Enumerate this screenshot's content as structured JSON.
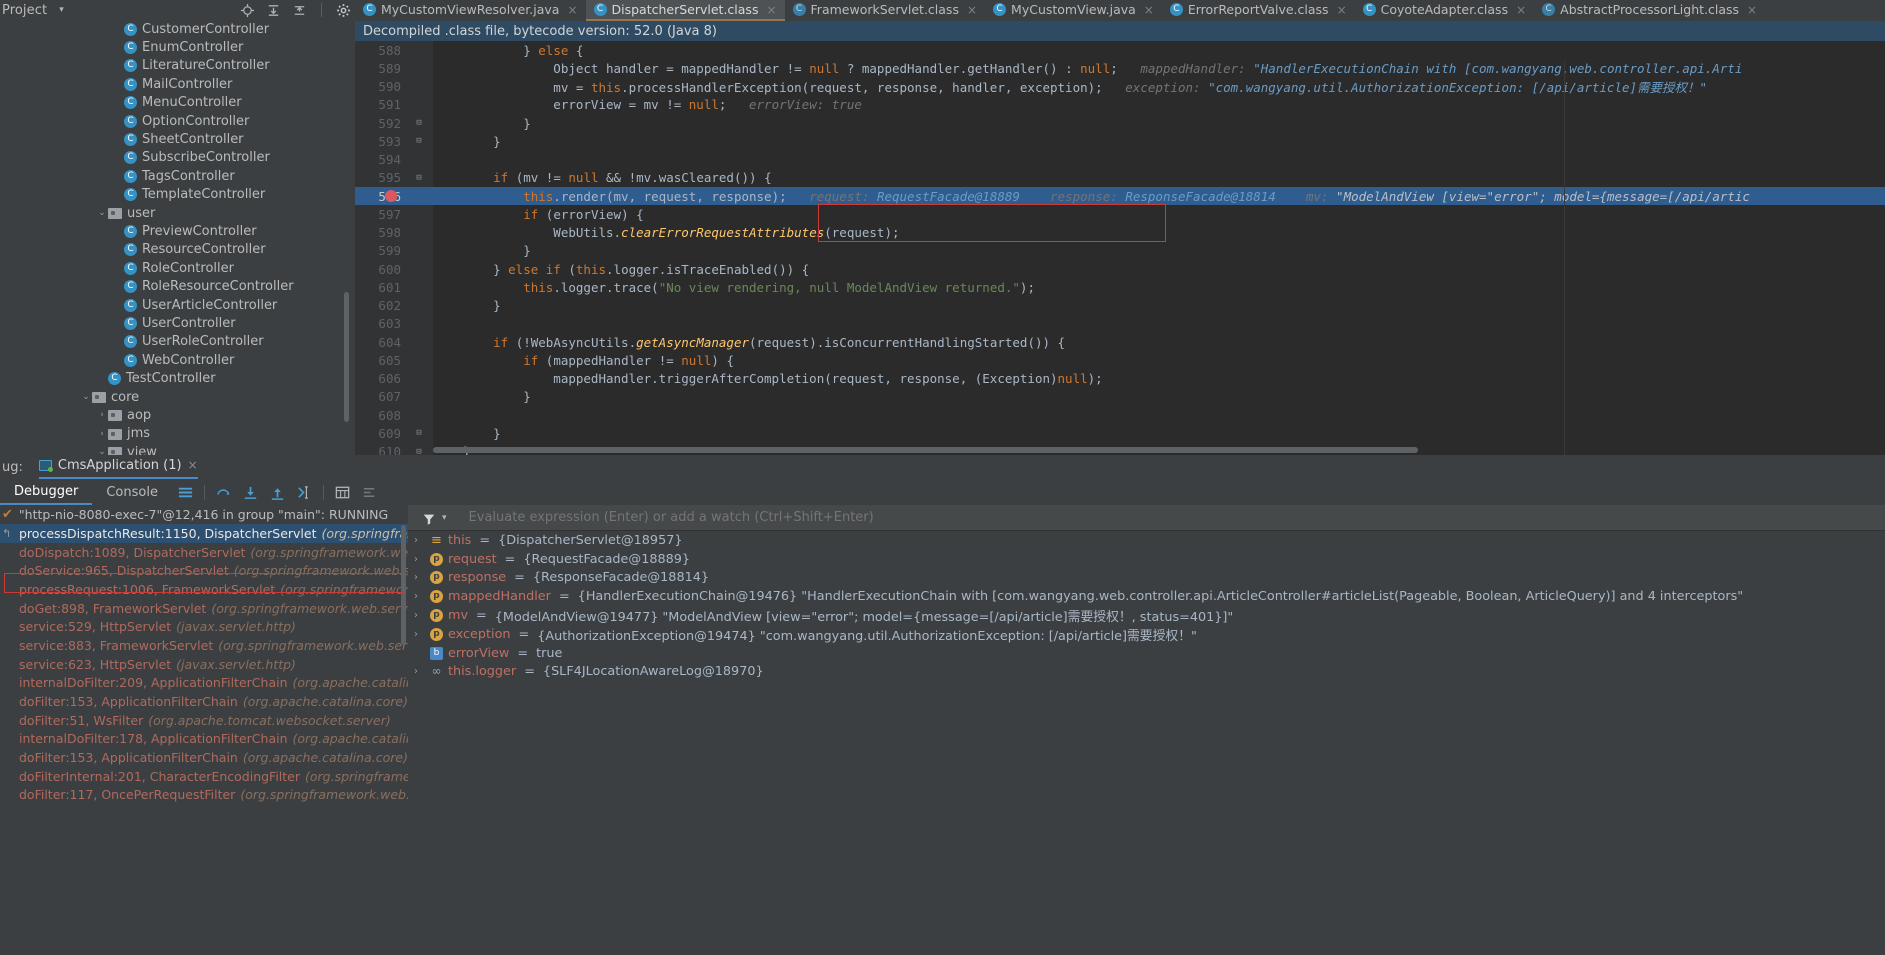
{
  "topbar": {
    "project_label": "Project",
    "caret": "▾",
    "icons": [
      "locate-icon",
      "expand-all-icon",
      "collapse-all-icon",
      "settings-gear-icon",
      "minimize-icon"
    ]
  },
  "editor_tabs": [
    {
      "label": "MyCustomViewResolver.java",
      "icon": "java-class-icon",
      "active": false,
      "close": "×"
    },
    {
      "label": "DispatcherServlet.class",
      "icon": "java-class-icon",
      "active": true,
      "close": "×"
    },
    {
      "label": "FrameworkServlet.class",
      "icon": "compiled-class-icon",
      "active": false,
      "close": "×"
    },
    {
      "label": "MyCustomView.java",
      "icon": "java-class-icon",
      "active": false,
      "close": "×"
    },
    {
      "label": "ErrorReportValve.class",
      "icon": "java-class-icon",
      "active": false,
      "close": "×"
    },
    {
      "label": "CoyoteAdapter.class",
      "icon": "java-class-icon",
      "active": false,
      "close": "×"
    },
    {
      "label": "AbstractProcessorLight.class",
      "icon": "compiled-class-icon",
      "active": false,
      "close": "×"
    }
  ],
  "project_tree": [
    {
      "label": "CustomerController",
      "kind": "class",
      "indent": 7,
      "twisty": ""
    },
    {
      "label": "EnumController",
      "kind": "class",
      "indent": 7,
      "twisty": ""
    },
    {
      "label": "LiteratureController",
      "kind": "class",
      "indent": 7,
      "twisty": ""
    },
    {
      "label": "MailController",
      "kind": "class",
      "indent": 7,
      "twisty": ""
    },
    {
      "label": "MenuController",
      "kind": "class",
      "indent": 7,
      "twisty": ""
    },
    {
      "label": "OptionController",
      "kind": "class",
      "indent": 7,
      "twisty": ""
    },
    {
      "label": "SheetController",
      "kind": "class",
      "indent": 7,
      "twisty": ""
    },
    {
      "label": "SubscribeController",
      "kind": "class",
      "indent": 7,
      "twisty": ""
    },
    {
      "label": "TagsController",
      "kind": "class",
      "indent": 7,
      "twisty": ""
    },
    {
      "label": "TemplateController",
      "kind": "class",
      "indent": 7,
      "twisty": ""
    },
    {
      "label": "user",
      "kind": "folder",
      "indent": 6,
      "twisty": "⌄"
    },
    {
      "label": "PreviewController",
      "kind": "class",
      "indent": 7,
      "twisty": ""
    },
    {
      "label": "ResourceController",
      "kind": "class",
      "indent": 7,
      "twisty": ""
    },
    {
      "label": "RoleController",
      "kind": "class",
      "indent": 7,
      "twisty": ""
    },
    {
      "label": "RoleResourceController",
      "kind": "class",
      "indent": 7,
      "twisty": ""
    },
    {
      "label": "UserArticleController",
      "kind": "class",
      "indent": 7,
      "twisty": ""
    },
    {
      "label": "UserController",
      "kind": "class",
      "indent": 7,
      "twisty": ""
    },
    {
      "label": "UserRoleController",
      "kind": "class",
      "indent": 7,
      "twisty": ""
    },
    {
      "label": "WebController",
      "kind": "class",
      "indent": 7,
      "twisty": ""
    },
    {
      "label": "TestController",
      "kind": "class",
      "indent": 6,
      "twisty": ""
    },
    {
      "label": "core",
      "kind": "folder",
      "indent": 5,
      "twisty": "⌄"
    },
    {
      "label": "aop",
      "kind": "folder",
      "indent": 6,
      "twisty": "›"
    },
    {
      "label": "jms",
      "kind": "folder",
      "indent": 6,
      "twisty": "›"
    },
    {
      "label": "view",
      "kind": "folder",
      "indent": 6,
      "twisty": "⌄"
    }
  ],
  "editor": {
    "banner": "Decompiled .class file, bytecode version: 52.0 (Java 8)",
    "first_line": 588,
    "lines": [
      {
        "num": 588,
        "fold": "",
        "html": "        } <span class='kw'>else</span> {"
      },
      {
        "num": 589,
        "fold": "",
        "html": "            Object handler = mappedHandler != <span class='kw'>null</span> ? mappedHandler.getHandler() : <span class='kw'>null</span>;   <span class='hint'>mappedHandler: </span><span class='hint2'>\"HandlerExecutionChain with [com.wangyang.web.controller.api.Arti</span>"
      },
      {
        "num": 590,
        "fold": "",
        "html": "            mv = <span class='kw'>this</span>.processHandlerException(request, response, handler, exception);   <span class='hint'>exception: </span><span class='hint2'>\"com.wangyang.util.AuthorizationException: [/api/article]需要授权！\"</span>"
      },
      {
        "num": 591,
        "fold": "",
        "html": "            errorView = mv != <span class='kw'>null</span>;   <span class='hint'>errorView: true</span>"
      },
      {
        "num": 592,
        "fold": "⊟",
        "html": "        }"
      },
      {
        "num": 593,
        "fold": "⊟",
        "html": "    }"
      },
      {
        "num": 594,
        "fold": "",
        "html": ""
      },
      {
        "num": 595,
        "fold": "⊟",
        "html": "    <span class='kw'>if</span> (mv != <span class='kw'>null</span> &amp;&amp; !mv.wasCleared()) {"
      },
      {
        "num": 596,
        "fold": "",
        "sel": true,
        "bp": true,
        "html": "        <span class='kw'>this</span>.render(mv, request, response);   <span class='hint'>request: </span><span class='hint2'>RequestFacade@18889</span>    <span class='hint'>response: </span><span class='hint2'>ResponseFacade@18814</span>    <span class='hint'>mv: </span><span class='hintw'>\"ModelAndView [view=\"error\"; model={message=[/api/artic</span>"
      },
      {
        "num": 597,
        "fold": "",
        "html": "        <span class='kw'>if</span> (errorView) {"
      },
      {
        "num": 598,
        "fold": "",
        "html": "            WebUtils.<span class='fn' style='font-style:italic'>clearErrorRequestAttributes</span>(request);"
      },
      {
        "num": 599,
        "fold": "",
        "html": "        }"
      },
      {
        "num": 600,
        "fold": "",
        "html": "    } <span class='kw'>else if</span> (<span class='kw'>this</span>.logger.isTraceEnabled()) {"
      },
      {
        "num": 601,
        "fold": "",
        "html": "        <span class='kw'>this</span>.logger.trace(<span class='str'>\"No view rendering, null ModelAndView returned.\"</span>);"
      },
      {
        "num": 602,
        "fold": "",
        "html": "    }"
      },
      {
        "num": 603,
        "fold": "",
        "html": ""
      },
      {
        "num": 604,
        "fold": "",
        "html": "    <span class='kw'>if</span> (!WebAsyncUtils.<span class='fn' style='font-style:italic'>getAsyncManager</span>(request).isConcurrentHandlingStarted()) {"
      },
      {
        "num": 605,
        "fold": "",
        "html": "        <span class='kw'>if</span> (mappedHandler != <span class='kw'>null</span>) {"
      },
      {
        "num": 606,
        "fold": "",
        "html": "            mappedHandler.triggerAfterCompletion(request, response, (Exception)<span class='kw'>null</span>);"
      },
      {
        "num": 607,
        "fold": "",
        "html": "        }"
      },
      {
        "num": 608,
        "fold": "",
        "html": ""
      },
      {
        "num": 609,
        "fold": "⊟",
        "html": "    }"
      },
      {
        "num": 610,
        "fold": "⊟",
        "html": "}"
      }
    ]
  },
  "debug": {
    "label": "ug:",
    "session_tab": "CmsApplication (1)",
    "session_close": "×",
    "tabs": [
      {
        "label": "Debugger",
        "active": true
      },
      {
        "label": "Console",
        "active": false
      }
    ],
    "toolbar_icons": [
      "layout-settings-icon",
      "step-over-icon",
      "step-into-icon",
      "step-out-icon",
      "run-to-cursor-icon",
      "evaluate-expression-icon",
      "mute-breakpoints-icon"
    ],
    "thread": "\"http-nio-8080-exec-7\"@12,416 in group \"main\": RUNNING",
    "frames": [
      {
        "method": "processDispatchResult:1150, DispatcherServlet",
        "pkg": "(org.springframework",
        "selected": true
      },
      {
        "method": "doDispatch:1089, DispatcherServlet",
        "pkg": "(org.springframework.web.servle",
        "selected": false
      },
      {
        "method": "doService:965, DispatcherServlet",
        "pkg": "(org.springframework.web.servlet)",
        "selected": false
      },
      {
        "method": "processRequest:1006, FrameworkServlet",
        "pkg": "(org.springframework.web.s",
        "selected": false
      },
      {
        "method": "doGet:898, FrameworkServlet",
        "pkg": "(org.springframework.web.servlet)",
        "selected": false
      },
      {
        "method": "service:529, HttpServlet",
        "pkg": "(javax.servlet.http)",
        "selected": false
      },
      {
        "method": "service:883, FrameworkServlet",
        "pkg": "(org.springframework.web.servlet)",
        "selected": false
      },
      {
        "method": "service:623, HttpServlet",
        "pkg": "(javax.servlet.http)",
        "selected": false
      },
      {
        "method": "internalDoFilter:209, ApplicationFilterChain",
        "pkg": "(org.apache.catalina.core",
        "selected": false
      },
      {
        "method": "doFilter:153, ApplicationFilterChain",
        "pkg": "(org.apache.catalina.core)",
        "selected": false
      },
      {
        "method": "doFilter:51, WsFilter",
        "pkg": "(org.apache.tomcat.websocket.server)",
        "selected": false
      },
      {
        "method": "internalDoFilter:178, ApplicationFilterChain",
        "pkg": "(org.apache.catalina.core",
        "selected": false
      },
      {
        "method": "doFilter:153, ApplicationFilterChain",
        "pkg": "(org.apache.catalina.core)",
        "selected": false
      },
      {
        "method": "doFilterInternal:201, CharacterEncodingFilter",
        "pkg": "(org.springframework.w",
        "selected": false
      },
      {
        "method": "doFilter:117, OncePerRequestFilter",
        "pkg": "(org.springframework.web.filter)",
        "selected": false
      }
    ],
    "eval_placeholder": "Evaluate expression (Enter) or add a watch (Ctrl+Shift+Enter)",
    "variables": [
      {
        "chevron": "›",
        "icon": "this-icon",
        "name": "this",
        "eq": "=",
        "value": "{DispatcherServlet@18957}"
      },
      {
        "chevron": "›",
        "icon": "param-icon",
        "name": "request",
        "eq": "=",
        "value": "{RequestFacade@18889}"
      },
      {
        "chevron": "›",
        "icon": "param-icon",
        "name": "response",
        "eq": "=",
        "value": "{ResponseFacade@18814}"
      },
      {
        "chevron": "›",
        "icon": "param-icon",
        "name": "mappedHandler",
        "eq": "=",
        "value": "{HandlerExecutionChain@19476} \"HandlerExecutionChain with [com.wangyang.web.controller.api.ArticleController#articleList(Pageable, Boolean, ArticleQuery)] and 4 interceptors\""
      },
      {
        "chevron": "›",
        "icon": "param-icon",
        "name": "mv",
        "eq": "=",
        "value": "{ModelAndView@19477} \"ModelAndView [view=\"error\"; model={message=[/api/article]需要授权！, status=401}]\""
      },
      {
        "chevron": "›",
        "icon": "param-icon",
        "name": "exception",
        "eq": "=",
        "value": "{AuthorizationException@19474} \"com.wangyang.util.AuthorizationException: [/api/article]需要授权！\""
      },
      {
        "chevron": "",
        "icon": "boolean-icon",
        "name": "errorView",
        "eq": "=",
        "value": "true"
      },
      {
        "chevron": "›",
        "icon": "field-icon",
        "name": "this.logger",
        "eq": "=",
        "value": "{SLF4JLocationAwareLog@18970}"
      }
    ]
  },
  "colors": {
    "bg_panel": "#3c3f41",
    "bg_editor": "#2b2b2b",
    "accent_blue": "#4a88c7",
    "selection_blue": "#2f5d8f",
    "banner_blue": "#2f4a63",
    "red_highlight": "#cc3b36",
    "keyword_orange": "#cc7832",
    "string_green": "#6a8759",
    "breakpoint_red": "#db5860"
  }
}
